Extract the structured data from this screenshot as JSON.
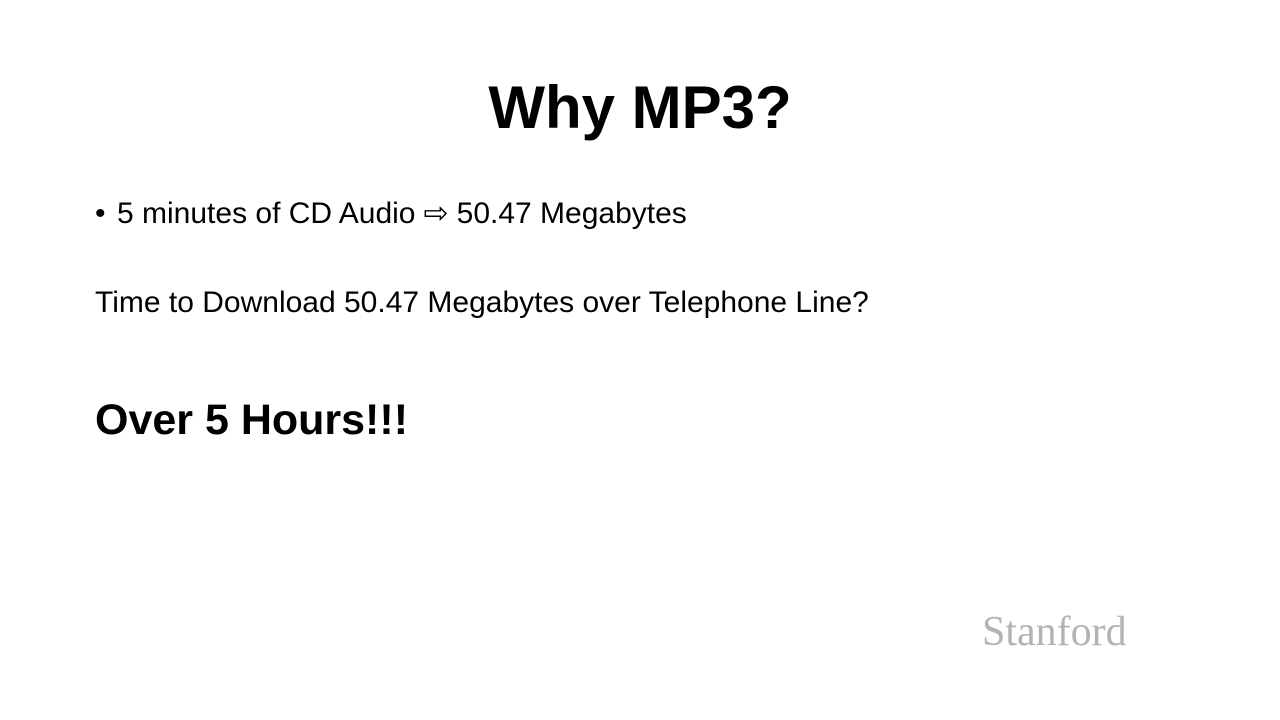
{
  "slide": {
    "title": "Why MP3?",
    "bullet": {
      "marker": "•",
      "before_arrow": "5 minutes of CD Audio",
      "arrow": "⇨",
      "after_arrow": "50.47 Megabytes"
    },
    "question": "Time to Download 50.47 Megabytes over Telephone Line?",
    "answer": "Over 5 Hours!!!",
    "logo": "Stanford"
  },
  "colors": {
    "background": "#ffffff",
    "text": "#000000",
    "logo": "#b3b3b3"
  }
}
